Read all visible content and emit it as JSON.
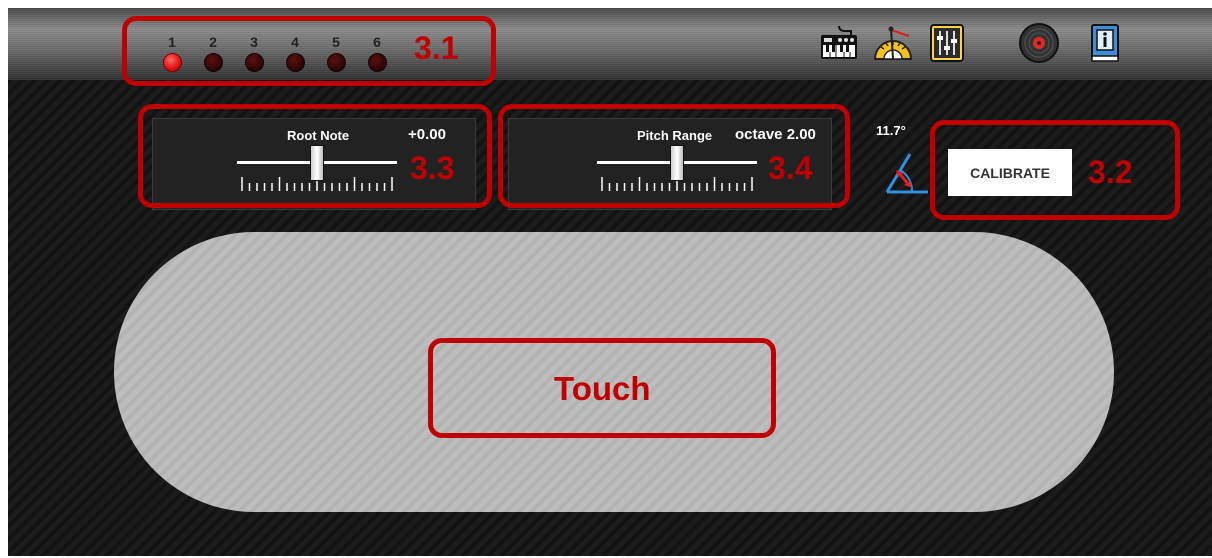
{
  "channels": [
    {
      "number": "1",
      "active": true
    },
    {
      "number": "2",
      "active": false
    },
    {
      "number": "3",
      "active": false
    },
    {
      "number": "4",
      "active": false
    },
    {
      "number": "5",
      "active": false
    },
    {
      "number": "6",
      "active": false
    }
  ],
  "toolbar_icons": [
    "keyboard-icon",
    "protractor-icon",
    "mixer-icon",
    "vinyl-record-icon",
    "info-book-icon"
  ],
  "root_note": {
    "label": "Root Note",
    "value": "+0.00",
    "level": 0.5
  },
  "pitch_range": {
    "label": "Pitch Range",
    "value": "octave 2.00",
    "level": 0.5
  },
  "tilt": {
    "angle": "11.7°"
  },
  "calibrate": {
    "label": "CALIBRATE"
  },
  "annotations": {
    "channels": "3.1",
    "calibrate": "3.2",
    "root_note": "3.3",
    "pitch_range": "3.4",
    "touch": "Touch"
  },
  "colors": {
    "annotation": "#c00000",
    "led_on": "#e01515",
    "led_off": "#3a0808",
    "touchpad": "#b8b8b8"
  }
}
